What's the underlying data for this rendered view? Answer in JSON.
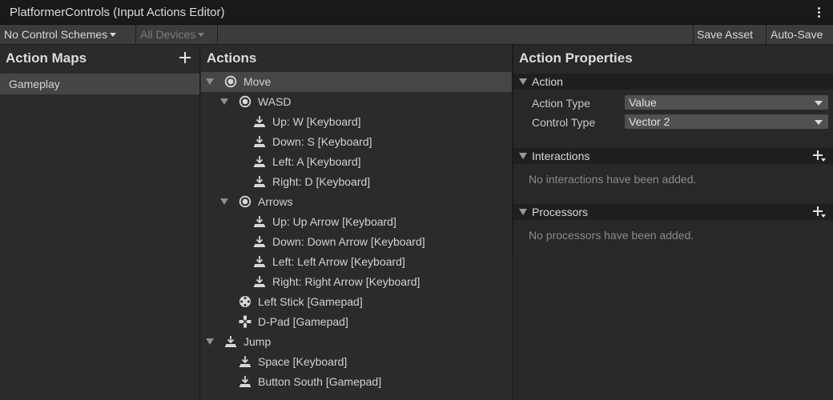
{
  "window": {
    "title": "PlatformerControls (Input Actions Editor)"
  },
  "toolbar": {
    "control_schemes": "No Control Schemes",
    "devices": "All Devices",
    "save_asset": "Save Asset",
    "auto_save": "Auto-Save"
  },
  "action_maps": {
    "header": "Action Maps",
    "items": [
      {
        "label": "Gameplay",
        "selected": true
      }
    ]
  },
  "actions": {
    "header": "Actions",
    "tree": [
      {
        "label": "Move",
        "icon": "value-action-icon",
        "expanded": true,
        "selected": true
      },
      {
        "label": "WASD",
        "icon": "composite-icon",
        "expanded": true
      },
      {
        "label": "Up: W [Keyboard]",
        "icon": "key-binding-icon"
      },
      {
        "label": "Down: S [Keyboard]",
        "icon": "key-binding-icon"
      },
      {
        "label": "Left: A [Keyboard]",
        "icon": "key-binding-icon"
      },
      {
        "label": "Right: D [Keyboard]",
        "icon": "key-binding-icon"
      },
      {
        "label": "Arrows",
        "icon": "composite-icon",
        "expanded": true
      },
      {
        "label": "Up: Up Arrow [Keyboard]",
        "icon": "key-binding-icon"
      },
      {
        "label": "Down: Down Arrow [Keyboard]",
        "icon": "key-binding-icon"
      },
      {
        "label": "Left: Left Arrow [Keyboard]",
        "icon": "key-binding-icon"
      },
      {
        "label": "Right: Right Arrow [Keyboard]",
        "icon": "key-binding-icon"
      },
      {
        "label": "Left Stick [Gamepad]",
        "icon": "gamepad-stick-icon"
      },
      {
        "label": "D-Pad [Gamepad]",
        "icon": "dpad-icon"
      },
      {
        "label": "Jump",
        "icon": "button-action-icon",
        "expanded": true
      },
      {
        "label": "Space [Keyboard]",
        "icon": "key-binding-icon"
      },
      {
        "label": "Button South [Gamepad]",
        "icon": "key-binding-icon"
      }
    ]
  },
  "properties": {
    "header": "Action Properties",
    "action_section": {
      "title": "Action",
      "action_type_label": "Action Type",
      "action_type_value": "Value",
      "control_type_label": "Control Type",
      "control_type_value": "Vector 2"
    },
    "interactions": {
      "title": "Interactions",
      "empty": "No interactions have been added."
    },
    "processors": {
      "title": "Processors",
      "empty": "No processors have been added."
    }
  },
  "colors": {
    "background": "#282828",
    "panel": "#2b2b2b",
    "selection": "#464646",
    "toolbar": "#3c3c3c"
  }
}
